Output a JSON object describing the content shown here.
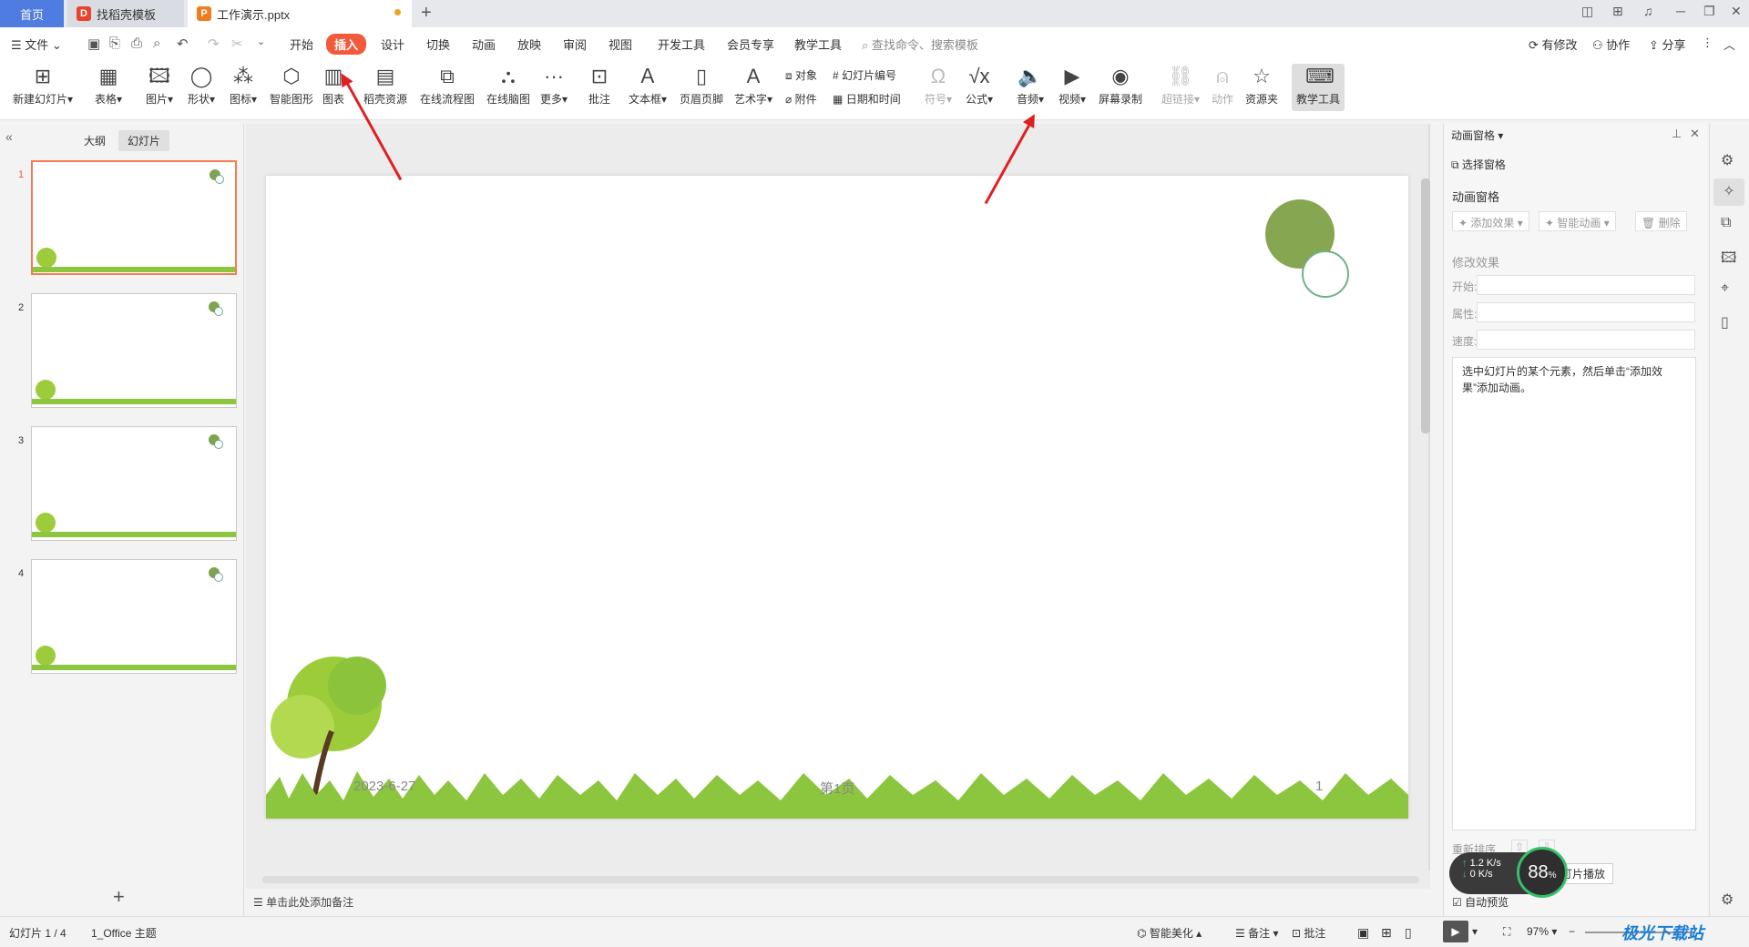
{
  "tabs": [
    {
      "label": "首页"
    },
    {
      "label": "找稻壳模板"
    },
    {
      "label": "工作演示.pptx"
    }
  ],
  "menu": {
    "file": "文件",
    "items": [
      "开始",
      "插入",
      "设计",
      "切换",
      "动画",
      "放映",
      "审阅",
      "视图",
      "开发工具",
      "会员专享",
      "教学工具"
    ],
    "active": "插入",
    "search_placeholder": "查找命令、搜索模板",
    "right": [
      "有修改",
      "协作",
      "分享"
    ]
  },
  "ribbon": {
    "new_slide": "新建幻灯片",
    "table": "表格",
    "picture": "图片",
    "shape": "形状",
    "icon": "图标",
    "smart_shape": "智能图形",
    "chart": "图表",
    "docer_res": "稻壳资源",
    "online_flow": "在线流程图",
    "online_mind": "在线脑图",
    "more": "更多",
    "comment": "批注",
    "textbox": "文本框",
    "header_footer": "页眉页脚",
    "art_text": "艺术字",
    "object": "对象",
    "attachment": "附件",
    "slide_number": "幻灯片编号",
    "date_time": "日期和时间",
    "symbol": "符号",
    "formula": "公式",
    "audio": "音频",
    "video": "视频",
    "screen_record": "屏幕录制",
    "hyperlink": "超链接",
    "action": "动作",
    "resource_folder": "资源夹",
    "teaching_tools": "教学工具"
  },
  "left_panel": {
    "outline_tab": "大纲",
    "slides_tab": "幻灯片",
    "slides": [
      {
        "num": "1"
      },
      {
        "num": "2"
      },
      {
        "num": "3"
      },
      {
        "num": "4"
      }
    ],
    "add": "+"
  },
  "slide": {
    "date": "2023-6-27",
    "page": "第1页",
    "number": "1"
  },
  "notes_placeholder": "单击此处添加备注",
  "animation_panel": {
    "title": "动画窗格",
    "select_pane": "选择窗格",
    "section": "动画窗格",
    "add_effect": "添加效果",
    "smart_anim": "智能动画",
    "delete": "删除",
    "modify": "修改效果",
    "start": "开始:",
    "property": "属性:",
    "speed": "速度:",
    "hint": "选中幻灯片的某个元素，然后单击“添加效果”添加动画。",
    "reorder": "重新排序",
    "play_btn": "灯片播放",
    "auto_preview": "自动预览"
  },
  "net_widget": {
    "up": "1.2",
    "down": "0",
    "unit": "K/s",
    "percent": "88",
    "pct_sign": "%"
  },
  "status": {
    "slide_pos": "幻灯片 1 / 4",
    "theme": "1_Office 主题",
    "beautify": "智能美化",
    "notes": "备注",
    "comments": "批注",
    "zoom": "97%"
  },
  "watermark": "极光下载站"
}
